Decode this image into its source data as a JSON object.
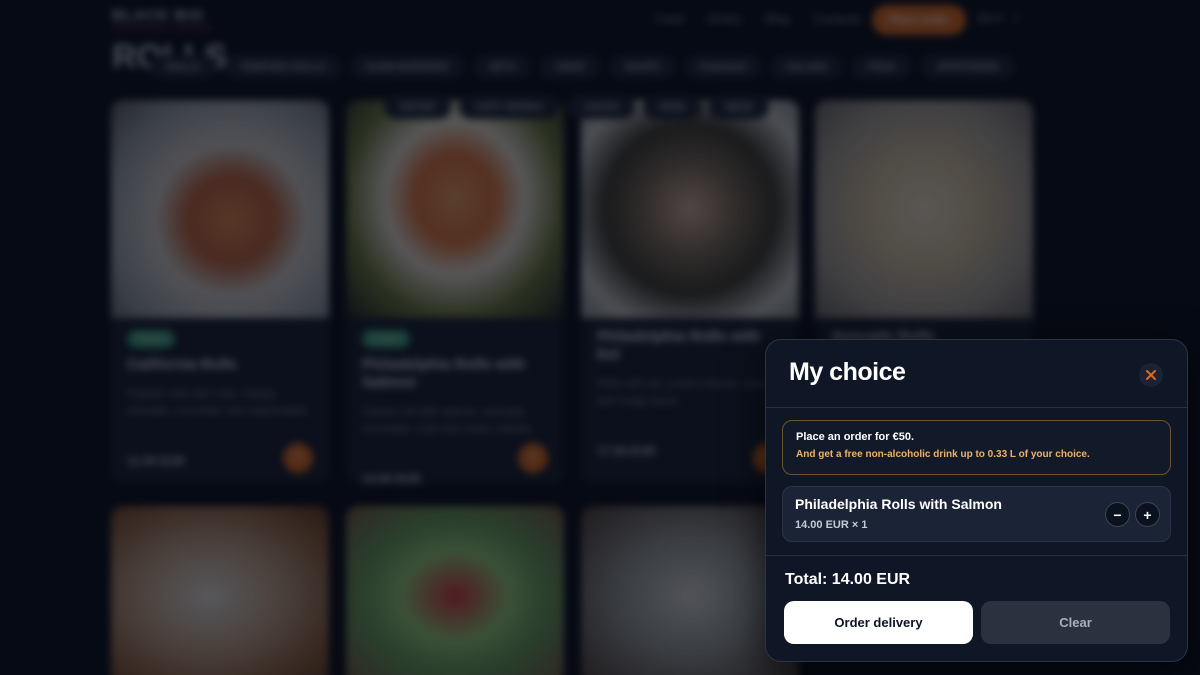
{
  "background": {
    "brand": "BLACK BIG",
    "brand_sub": "SUSHI DELIVERY & TAKEAWAY",
    "nav": [
      "Food",
      "Drinks",
      "Blog",
      "Contacts"
    ],
    "cta": "Place order",
    "lang": "EN ▾",
    "page_title": "ROLLS",
    "categories_row1": [
      "ROLLS",
      "TEMPURA ROLLS",
      "SUSHI BURGERS",
      "SETS",
      "UDON",
      "SOUPS",
      "Pokebowl",
      "SALADS",
      "PIZZA",
      "APPETIZERS"
    ],
    "categories_row2": [
      "WATER",
      "SOFT DRINKS",
      "JUICES",
      "WINE",
      "BEER"
    ],
    "cards": [
      {
        "badge": "Popular",
        "title": "California Rolls",
        "desc": "Popular rolls with crab, mango, avocado, cucumber and mayonnaise.",
        "price": "11.00 EUR"
      },
      {
        "badge": "Popular",
        "title": "Philadelphia Rolls with Salmon",
        "desc": "Classic roll with salmon, avocado, cucumber, crab and cream cheese.",
        "price": "14.00 EUR"
      },
      {
        "badge": "",
        "title": "Philadelphia Rolls with Eel",
        "desc": "Rolls with eel, cream cheese, sesame and unagi sauce.",
        "price": "17.00 EUR"
      },
      {
        "badge": "",
        "title": "Avocado Rolls",
        "desc": "",
        "price": ""
      }
    ]
  },
  "cart": {
    "title": "My choice",
    "close_icon": "close-icon",
    "promo_title": "Place an order for €50.",
    "promo_sub": "And get a free non-alcoholic drink up to 0.33 L of your choice.",
    "item": {
      "name": "Philadelphia Rolls with Salmon",
      "qty_line": "14.00 EUR × 1",
      "minus": "−",
      "plus": "+"
    },
    "total": "Total: 14.00 EUR",
    "order_button": "Order delivery",
    "clear_button": "Clear",
    "colors": {
      "accent": "#e06a1b",
      "promo_text": "#f0b165",
      "panel_bg": "#0f1626"
    }
  }
}
